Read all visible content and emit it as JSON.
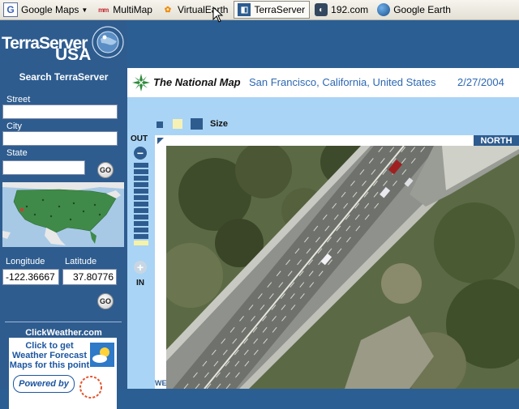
{
  "bookmarks": [
    {
      "label": "Google Maps",
      "icon": "google-icon",
      "has_dropdown": true
    },
    {
      "label": "MultiMap",
      "icon": "multimap-icon"
    },
    {
      "label": "VirtualEarth",
      "icon": "virtualearth-icon"
    },
    {
      "label": "TerraServer",
      "icon": "terraserver-icon",
      "active": true
    },
    {
      "label": "192.com",
      "icon": "192com-icon"
    },
    {
      "label": "Google Earth",
      "icon": "google-earth-icon"
    }
  ],
  "sidebar": {
    "logo_line1": "TerraServer",
    "logo_line2": "USA",
    "search_title": "Search TerraServer",
    "street_label": "Street",
    "street_value": "",
    "city_label": "City",
    "city_value": "",
    "state_label": "State",
    "state_value": "",
    "go_label": "GO",
    "longitude_label": "Longitude",
    "latitude_label": "Latitude",
    "longitude_value": "-122.36667",
    "latitude_value": "37.80776",
    "weather_title": "ClickWeather.com",
    "weather_text": "Click to get Weather Forecast Maps for this point",
    "powered_by": "Powered by"
  },
  "main": {
    "brand": "The National Map",
    "location": "San Francisco, California, United States",
    "date": "2/27/2004",
    "size_label": "Size",
    "zoom_out_label": "OUT",
    "zoom_in_label": "IN",
    "zoom_level": 12,
    "zoom_levels_total": 13,
    "north_label": "NORTH",
    "west_label": "WEST"
  },
  "colors": {
    "sidebar_bg": "#2e5c8f",
    "content_bg": "#a9d4f5",
    "link_blue": "#2d68b3"
  }
}
